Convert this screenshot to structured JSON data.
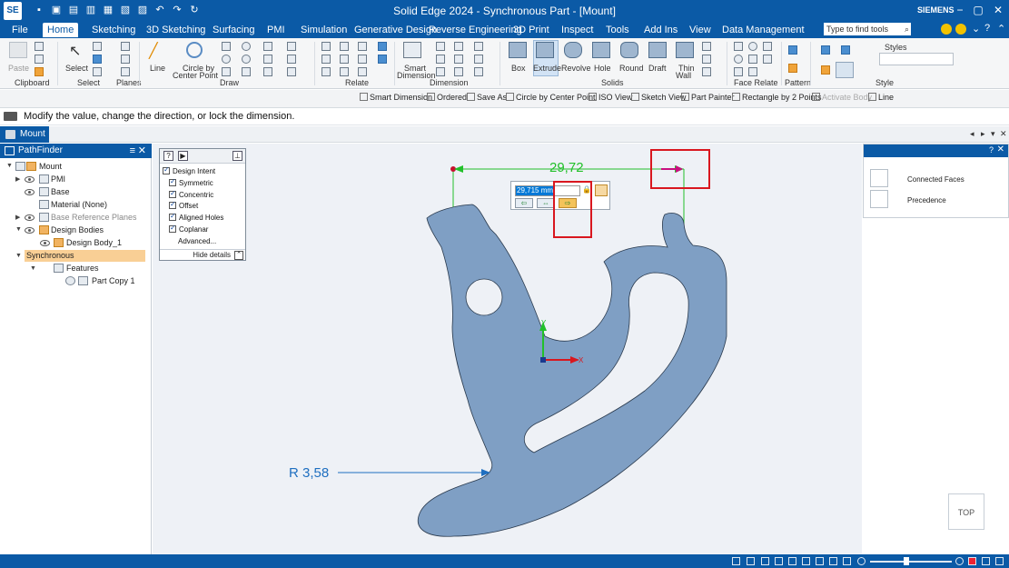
{
  "app": {
    "logo": "SE",
    "title": "Solid Edge 2024 - Synchronous Part - [Mount]",
    "brand": "SIEMENS"
  },
  "menu": {
    "file": "File",
    "tabs": [
      "Home",
      "Sketching",
      "3D Sketching",
      "Surfacing",
      "PMI",
      "Simulation",
      "Generative Design",
      "Reverse Engineering",
      "3D Print",
      "Inspect",
      "Tools",
      "Add Ins",
      "View",
      "Data Management"
    ],
    "active_tab": "Home",
    "search_placeholder": "Type to find tools"
  },
  "ribbon": {
    "clipboard": {
      "paste": "Paste",
      "label": "Clipboard"
    },
    "select": {
      "select": "Select",
      "label": "Select"
    },
    "planes": {
      "label": "Planes"
    },
    "draw": {
      "line": "Line",
      "circle": "Circle by",
      "circle2": "Center Point",
      "label": "Draw"
    },
    "relate": {
      "label": "Relate"
    },
    "dimension": {
      "smart": "Smart",
      "smart2": "Dimension",
      "label": "Dimension"
    },
    "solids": {
      "box": "Box",
      "extrude": "Extrude",
      "revolve": "Revolve",
      "hole": "Hole",
      "round": "Round",
      "draft": "Draft",
      "thin": "Thin",
      "wall": "Wall",
      "label": "Solids"
    },
    "face_relate": {
      "label": "Face Relate"
    },
    "pattern": {
      "label": "Pattern"
    },
    "style": {
      "styles": "Styles",
      "label": "Style"
    }
  },
  "command_bar": [
    "Smart Dimension",
    "Ordered",
    "Save As",
    "Circle by Center Point",
    "ISO View",
    "Sketch View",
    "Part Painter",
    "Rectangle by 2 Points",
    "Activate Body",
    "Line"
  ],
  "prompt": "Modify the value, change the direction, or lock the dimension.",
  "doc_tab": "Mount",
  "pathfinder": {
    "title": "PathFinder",
    "items": [
      {
        "label": "Mount"
      },
      {
        "label": "PMI"
      },
      {
        "label": "Base"
      },
      {
        "label": "Material (None)"
      },
      {
        "label": "Base Reference Planes"
      },
      {
        "label": "Design Bodies"
      },
      {
        "label": "Design Body_1"
      },
      {
        "label": "Synchronous"
      },
      {
        "label": "Features"
      },
      {
        "label": "Part Copy 1"
      }
    ]
  },
  "design_intent": {
    "title": "Design Intent",
    "options": [
      "Symmetric",
      "Concentric",
      "Offset",
      "Aligned Holes",
      "Coplanar"
    ],
    "advanced": "Advanced...",
    "hide": "Hide details"
  },
  "dimension": {
    "value_display": "29,72",
    "edit_value": "29,715 mm",
    "radius_label": "R 3,58"
  },
  "right_panel": {
    "items": [
      {
        "label": "Connected Faces"
      },
      {
        "label": "Precedence"
      }
    ]
  },
  "axes": {
    "x": "X",
    "y": "Y"
  },
  "view_cube": "TOP",
  "colors": {
    "accent": "#0b5aa6",
    "part_fill": "#7f9fc4",
    "dimension": "#22c02a",
    "radius": "#1f6fc0",
    "highlight": "#d9171f"
  }
}
